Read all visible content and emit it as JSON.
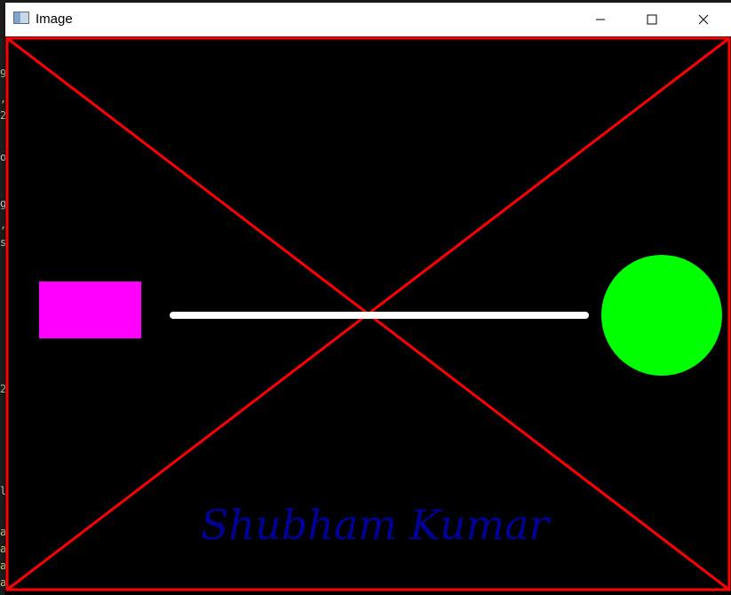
{
  "window": {
    "title": "Image",
    "icon": "image-app-icon",
    "controls": [
      "minimize-icon",
      "maximize-icon",
      "close-icon"
    ]
  },
  "background_glyphs": [
    "9",
    ",",
    "2",
    "o",
    "g",
    ",",
    "s",
    "2",
    "l",
    "a",
    "a",
    "a",
    "a"
  ],
  "canvas": {
    "background_color": "#000000",
    "border_color": "#ff0000",
    "diagonal_color": "#ff0000",
    "rectangle_color": "#ff00ff",
    "line_color": "#ffffff",
    "circle_color": "#00ff00",
    "text_color": "#000099",
    "text": "Shubham  Kumar"
  }
}
